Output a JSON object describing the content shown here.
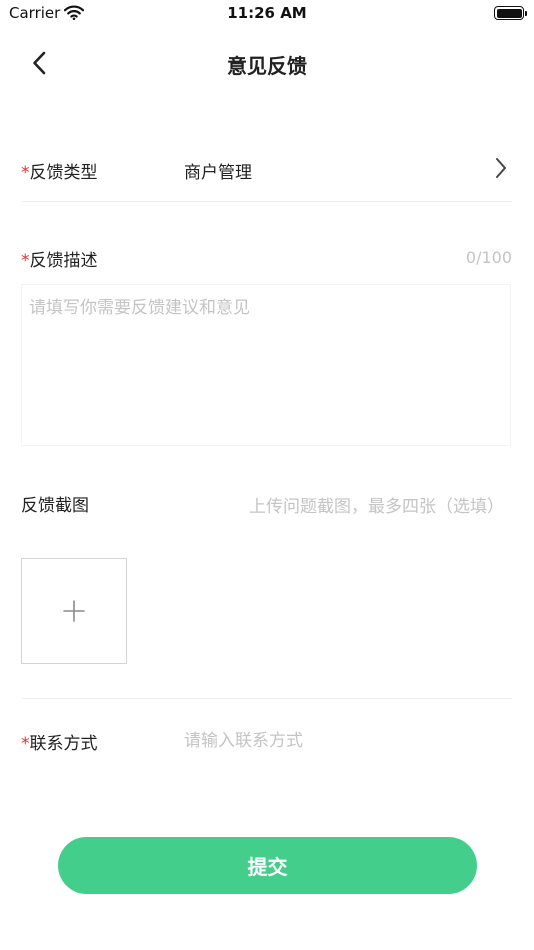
{
  "status_bar": {
    "carrier": "Carrier",
    "time": "11:26 AM"
  },
  "nav": {
    "title": "意见反馈"
  },
  "form": {
    "required_mark": "*",
    "type": {
      "label": "反馈类型",
      "value": "商户管理"
    },
    "description": {
      "label": "反馈描述",
      "count": "0/100",
      "placeholder": "请填写你需要反馈建议和意见"
    },
    "screenshot": {
      "label": "反馈截图",
      "hint": "上传问题截图，最多四张（选填）"
    },
    "contact": {
      "label": "联系方式",
      "placeholder": "请输入联系方式"
    }
  },
  "submit": {
    "label": "提交"
  },
  "colors": {
    "accent": "#43ce8c",
    "required": "#e2312d",
    "placeholder": "#c4c4c4"
  }
}
